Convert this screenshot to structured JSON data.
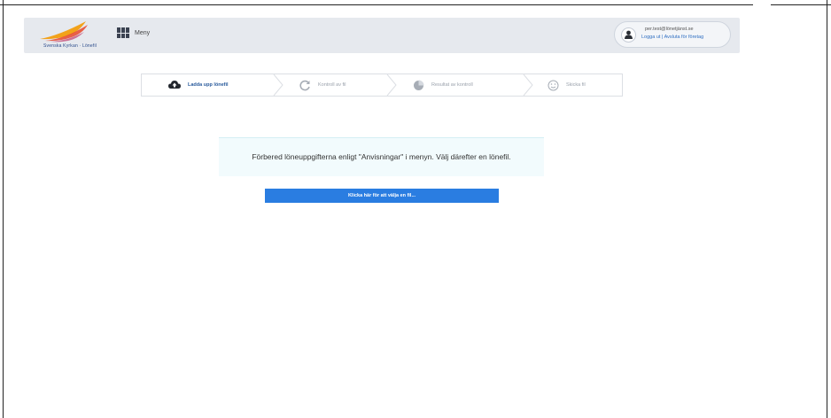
{
  "header": {
    "logo_text": "Svenska Kyrkan · Lönefil",
    "menu_label": "Meny",
    "user": {
      "name": "per.test@lönetjänst.se",
      "links": "Logga ut | Avsluta för företag"
    }
  },
  "steps": [
    {
      "label": "Ladda upp lönefil",
      "icon": "cloud-upload-icon",
      "active": true
    },
    {
      "label": "Kontroll av fil",
      "icon": "refresh-icon",
      "active": false
    },
    {
      "label": "Resultat av kontroll",
      "icon": "pie-chart-icon",
      "active": false
    },
    {
      "label": "Skicka fil",
      "icon": "smiley-icon",
      "active": false
    }
  ],
  "info": {
    "text": "Förbered löneuppgifterna enligt \"Anvisningar\" i menyn. Välj därefter en lönefil."
  },
  "upload_button": {
    "label": "Klicka här för att välja en fil..."
  },
  "colors": {
    "accent": "#2a7de1",
    "topbar": "#e6e9ee",
    "info_bg": "#f2fbfd",
    "active_step": "#2a5b9c"
  }
}
